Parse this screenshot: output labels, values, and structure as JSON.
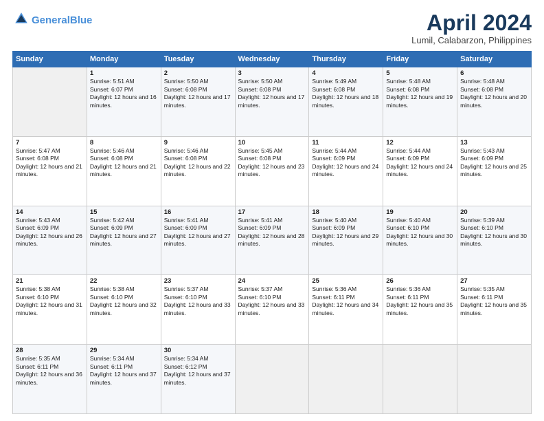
{
  "header": {
    "logo_line1": "General",
    "logo_line2": "Blue",
    "month": "April 2024",
    "location": "Lumil, Calabarzon, Philippines"
  },
  "weekdays": [
    "Sunday",
    "Monday",
    "Tuesday",
    "Wednesday",
    "Thursday",
    "Friday",
    "Saturday"
  ],
  "weeks": [
    [
      {
        "day": "",
        "empty": true
      },
      {
        "day": "1",
        "rise": "5:51 AM",
        "set": "6:07 PM",
        "daylight": "12 hours and 16 minutes."
      },
      {
        "day": "2",
        "rise": "5:50 AM",
        "set": "6:08 PM",
        "daylight": "12 hours and 17 minutes."
      },
      {
        "day": "3",
        "rise": "5:50 AM",
        "set": "6:08 PM",
        "daylight": "12 hours and 17 minutes."
      },
      {
        "day": "4",
        "rise": "5:49 AM",
        "set": "6:08 PM",
        "daylight": "12 hours and 18 minutes."
      },
      {
        "day": "5",
        "rise": "5:48 AM",
        "set": "6:08 PM",
        "daylight": "12 hours and 19 minutes."
      },
      {
        "day": "6",
        "rise": "5:48 AM",
        "set": "6:08 PM",
        "daylight": "12 hours and 20 minutes."
      }
    ],
    [
      {
        "day": "7",
        "rise": "5:47 AM",
        "set": "6:08 PM",
        "daylight": "12 hours and 21 minutes."
      },
      {
        "day": "8",
        "rise": "5:46 AM",
        "set": "6:08 PM",
        "daylight": "12 hours and 21 minutes."
      },
      {
        "day": "9",
        "rise": "5:46 AM",
        "set": "6:08 PM",
        "daylight": "12 hours and 22 minutes."
      },
      {
        "day": "10",
        "rise": "5:45 AM",
        "set": "6:08 PM",
        "daylight": "12 hours and 23 minutes."
      },
      {
        "day": "11",
        "rise": "5:44 AM",
        "set": "6:09 PM",
        "daylight": "12 hours and 24 minutes."
      },
      {
        "day": "12",
        "rise": "5:44 AM",
        "set": "6:09 PM",
        "daylight": "12 hours and 24 minutes."
      },
      {
        "day": "13",
        "rise": "5:43 AM",
        "set": "6:09 PM",
        "daylight": "12 hours and 25 minutes."
      }
    ],
    [
      {
        "day": "14",
        "rise": "5:43 AM",
        "set": "6:09 PM",
        "daylight": "12 hours and 26 minutes."
      },
      {
        "day": "15",
        "rise": "5:42 AM",
        "set": "6:09 PM",
        "daylight": "12 hours and 27 minutes."
      },
      {
        "day": "16",
        "rise": "5:41 AM",
        "set": "6:09 PM",
        "daylight": "12 hours and 27 minutes."
      },
      {
        "day": "17",
        "rise": "5:41 AM",
        "set": "6:09 PM",
        "daylight": "12 hours and 28 minutes."
      },
      {
        "day": "18",
        "rise": "5:40 AM",
        "set": "6:09 PM",
        "daylight": "12 hours and 29 minutes."
      },
      {
        "day": "19",
        "rise": "5:40 AM",
        "set": "6:10 PM",
        "daylight": "12 hours and 30 minutes."
      },
      {
        "day": "20",
        "rise": "5:39 AM",
        "set": "6:10 PM",
        "daylight": "12 hours and 30 minutes."
      }
    ],
    [
      {
        "day": "21",
        "rise": "5:38 AM",
        "set": "6:10 PM",
        "daylight": "12 hours and 31 minutes."
      },
      {
        "day": "22",
        "rise": "5:38 AM",
        "set": "6:10 PM",
        "daylight": "12 hours and 32 minutes."
      },
      {
        "day": "23",
        "rise": "5:37 AM",
        "set": "6:10 PM",
        "daylight": "12 hours and 33 minutes."
      },
      {
        "day": "24",
        "rise": "5:37 AM",
        "set": "6:10 PM",
        "daylight": "12 hours and 33 minutes."
      },
      {
        "day": "25",
        "rise": "5:36 AM",
        "set": "6:11 PM",
        "daylight": "12 hours and 34 minutes."
      },
      {
        "day": "26",
        "rise": "5:36 AM",
        "set": "6:11 PM",
        "daylight": "12 hours and 35 minutes."
      },
      {
        "day": "27",
        "rise": "5:35 AM",
        "set": "6:11 PM",
        "daylight": "12 hours and 35 minutes."
      }
    ],
    [
      {
        "day": "28",
        "rise": "5:35 AM",
        "set": "6:11 PM",
        "daylight": "12 hours and 36 minutes."
      },
      {
        "day": "29",
        "rise": "5:34 AM",
        "set": "6:11 PM",
        "daylight": "12 hours and 37 minutes."
      },
      {
        "day": "30",
        "rise": "5:34 AM",
        "set": "6:12 PM",
        "daylight": "12 hours and 37 minutes."
      },
      {
        "day": "",
        "empty": true
      },
      {
        "day": "",
        "empty": true
      },
      {
        "day": "",
        "empty": true
      },
      {
        "day": "",
        "empty": true
      }
    ]
  ]
}
